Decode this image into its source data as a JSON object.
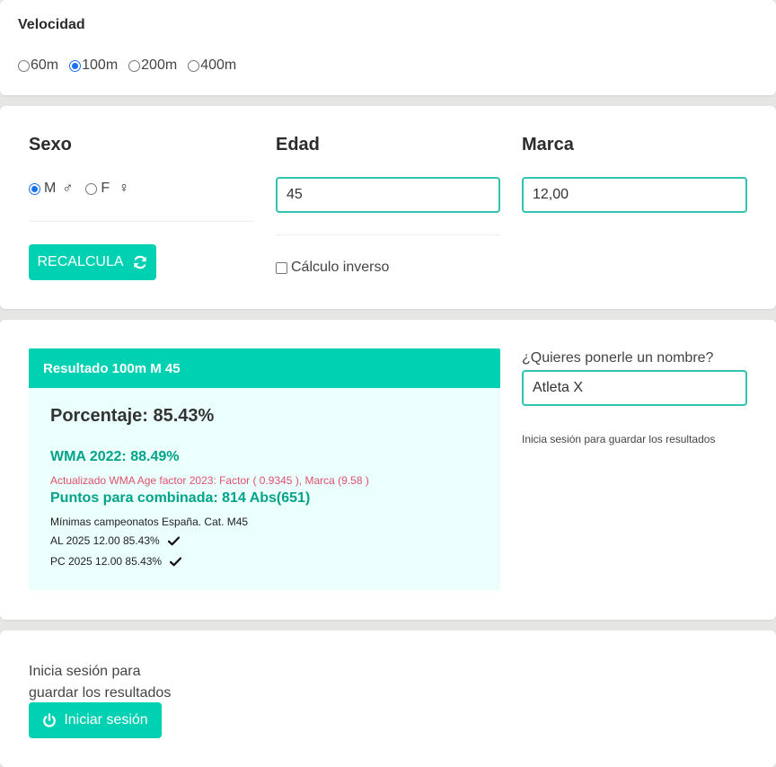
{
  "speed": {
    "title": "Velocidad",
    "options": [
      "60m",
      "100m",
      "200m",
      "400m"
    ],
    "selected": "100m"
  },
  "form": {
    "sex_title": "Sexo",
    "age_title": "Edad",
    "mark_title": "Marca",
    "sex_options": [
      {
        "label": "M",
        "glyph": "♂",
        "checked": true
      },
      {
        "label": "F",
        "glyph": "♀",
        "checked": false
      }
    ],
    "age_value": "45",
    "mark_value": "12,00",
    "recalc_label": "RECALCULA",
    "inverse_label": "Cálculo inverso",
    "inverse_checked": false
  },
  "result": {
    "header": "Resultado 100m M 45",
    "percentage": "Porcentaje: 85.43%",
    "wma": "WMA 2022: 88.49%",
    "updated": "Actualizado WMA Age factor 2023: Factor ( 0.9345 ), Marca (9.58 )",
    "points": "Puntos para combinada: 814 Abs(651)",
    "minimums_title": "Mínimas campeonatos España. Cat. M45",
    "minimums": [
      {
        "text": "AL 2025 12.00 85.43%",
        "met": true
      },
      {
        "text": "PC 2025 12.00 85.43%",
        "met": true
      }
    ],
    "name_label": "¿Quieres ponerle un nombre?",
    "name_value": "Atleta X",
    "save_note": "Inicia sesión para guardar los resultados"
  },
  "login": {
    "text": "Inicia sesión para guardar los resultados",
    "button_label": "Iniciar sesión"
  },
  "colors": {
    "accent": "#00d1b2",
    "accent_dark": "#00a38a",
    "result_bg": "#ebfffc",
    "warning": "#e0506e"
  },
  "icons": {
    "recalc": "refresh-icon",
    "login": "power-icon",
    "check": "check-icon"
  }
}
